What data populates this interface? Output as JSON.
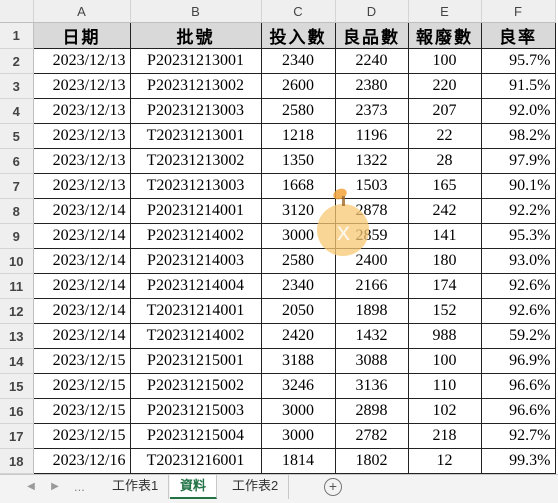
{
  "columns": [
    "A",
    "B",
    "C",
    "D",
    "E",
    "F"
  ],
  "headers": [
    "日期",
    "批號",
    "投入數",
    "良品數",
    "報廢數",
    "良率"
  ],
  "rows": [
    [
      "2023/12/13",
      "P20231213001",
      "2340",
      "2240",
      "100",
      "95.7%"
    ],
    [
      "2023/12/13",
      "P20231213002",
      "2600",
      "2380",
      "220",
      "91.5%"
    ],
    [
      "2023/12/13",
      "P20231213003",
      "2580",
      "2373",
      "207",
      "92.0%"
    ],
    [
      "2023/12/13",
      "T20231213001",
      "1218",
      "1196",
      "22",
      "98.2%"
    ],
    [
      "2023/12/13",
      "T20231213002",
      "1350",
      "1322",
      "28",
      "97.9%"
    ],
    [
      "2023/12/13",
      "T20231213003",
      "1668",
      "1503",
      "165",
      "90.1%"
    ],
    [
      "2023/12/14",
      "P20231214001",
      "3120",
      "2878",
      "242",
      "92.2%"
    ],
    [
      "2023/12/14",
      "P20231214002",
      "3000",
      "2859",
      "141",
      "95.3%"
    ],
    [
      "2023/12/14",
      "P20231214003",
      "2580",
      "2400",
      "180",
      "93.0%"
    ],
    [
      "2023/12/14",
      "P20231214004",
      "2340",
      "2166",
      "174",
      "92.6%"
    ],
    [
      "2023/12/14",
      "T20231214001",
      "2050",
      "1898",
      "152",
      "92.6%"
    ],
    [
      "2023/12/14",
      "T20231214002",
      "2420",
      "1432",
      "988",
      "59.2%"
    ],
    [
      "2023/12/15",
      "P20231215001",
      "3188",
      "3088",
      "100",
      "96.9%"
    ],
    [
      "2023/12/15",
      "P20231215002",
      "3246",
      "3136",
      "110",
      "96.6%"
    ],
    [
      "2023/12/15",
      "P20231215003",
      "3000",
      "2898",
      "102",
      "96.6%"
    ],
    [
      "2023/12/15",
      "P20231215004",
      "3000",
      "2782",
      "218",
      "92.7%"
    ],
    [
      "2023/12/16",
      "T20231216001",
      "1814",
      "1802",
      "12",
      "99.3%"
    ]
  ],
  "sheet_tabs": [
    "工作表1",
    "資料",
    "工作表2"
  ],
  "active_tab": "資料",
  "tab_nav": {
    "prev": "◀",
    "next": "▶",
    "more": "...",
    "add": "+"
  },
  "watermark": {
    "letter": "x",
    "colors": {
      "body": "#f7c873",
      "leaf": "#f2a23a"
    }
  }
}
